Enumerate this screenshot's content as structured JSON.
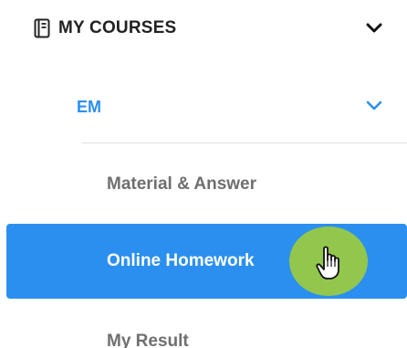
{
  "menu": {
    "title": "MY COURSES",
    "title_icon": "book-icon",
    "expand_icon": "chevron-down-icon"
  },
  "course": {
    "name": "EM",
    "expand_icon": "chevron-down-icon",
    "accent_color": "#2b8ff0"
  },
  "items": [
    {
      "label": "Material & Answer",
      "active": false
    },
    {
      "label": "Online Homework",
      "active": true
    },
    {
      "label": "My Result",
      "active": false
    }
  ],
  "cursor": {
    "icon": "hand-pointer-icon",
    "halo_color": "#9bcb3e"
  }
}
